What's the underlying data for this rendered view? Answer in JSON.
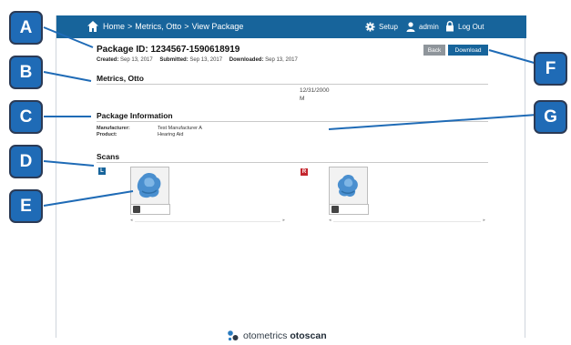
{
  "nav": {
    "breadcrumb": [
      "Home",
      "Metrics, Otto",
      "View Package"
    ],
    "separator": ">",
    "setup": "Setup",
    "user": "admin",
    "logout": "Log Out"
  },
  "package": {
    "title": "Package ID: 1234567-1590618919",
    "created_label": "Created:",
    "created": "Sep 13, 2017",
    "submitted_label": "Submitted:",
    "submitted": "Sep 13, 2017",
    "downloaded_label": "Downloaded:",
    "downloaded": "Sep 13, 2017"
  },
  "buttons": {
    "back": "Back",
    "download": "Download"
  },
  "patient": {
    "name": "Metrics, Otto",
    "dob": "12/31/2000",
    "sex": "M"
  },
  "package_info": {
    "title": "Package Information",
    "manufacturer_label": "Manufacturer:",
    "manufacturer": "Test Manufacturer A",
    "product_label": "Product:",
    "product": "Hearing Aid"
  },
  "scans": {
    "title": "Scans",
    "left_badge": "L",
    "right_badge": "R"
  },
  "footer": {
    "brand": "otometrics",
    "product": "otoscan"
  },
  "callouts": [
    "A",
    "B",
    "C",
    "D",
    "E",
    "F",
    "G"
  ],
  "colors": {
    "header": "#17649b",
    "callout": "#1f6bb6",
    "left_ear": "#17649b",
    "right_ear": "#c4262e",
    "scan_model": "#4a8fcf"
  },
  "icons": [
    "home-icon",
    "gear-icon",
    "user-icon",
    "lock-icon",
    "camera-icon",
    "scroll-left-icon",
    "scroll-right-icon",
    "otometrics-logo-icon"
  ]
}
